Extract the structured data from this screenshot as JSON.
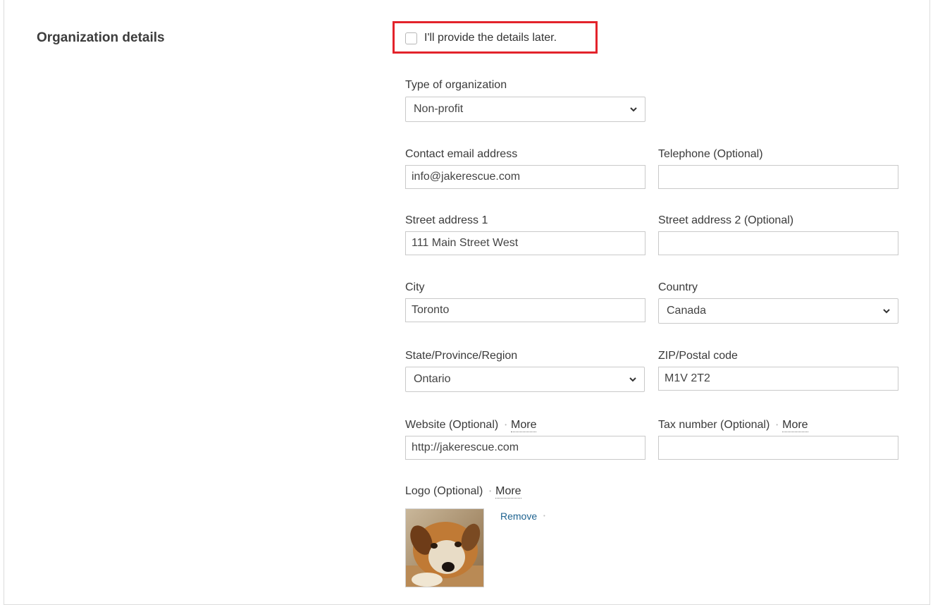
{
  "section": {
    "title": "Organization details"
  },
  "later": {
    "label": "I'll provide the details later.",
    "checked": false
  },
  "org_type": {
    "label": "Type of organization",
    "value": "Non-profit"
  },
  "email": {
    "label": "Contact email address",
    "value": "info@jakerescue.com"
  },
  "phone": {
    "label": "Telephone (Optional)",
    "value": ""
  },
  "street1": {
    "label": "Street address 1",
    "value": "111 Main Street West"
  },
  "street2": {
    "label": "Street address 2 (Optional)",
    "value": ""
  },
  "city": {
    "label": "City",
    "value": "Toronto"
  },
  "country": {
    "label": "Country",
    "value": "Canada"
  },
  "state": {
    "label": "State/Province/Region",
    "value": "Ontario"
  },
  "zip": {
    "label": "ZIP/Postal code",
    "value": "M1V 2T2"
  },
  "website": {
    "label": "Website (Optional)",
    "more": "More",
    "value": "http://jakerescue.com"
  },
  "tax": {
    "label": "Tax number (Optional)",
    "more": "More",
    "value": ""
  },
  "logo": {
    "label": "Logo (Optional)",
    "more": "More",
    "remove": "Remove",
    "image": "dog-photo"
  },
  "colors": {
    "highlight": "#e3232b",
    "link": "#1f6390",
    "border": "#c9c9c9"
  }
}
